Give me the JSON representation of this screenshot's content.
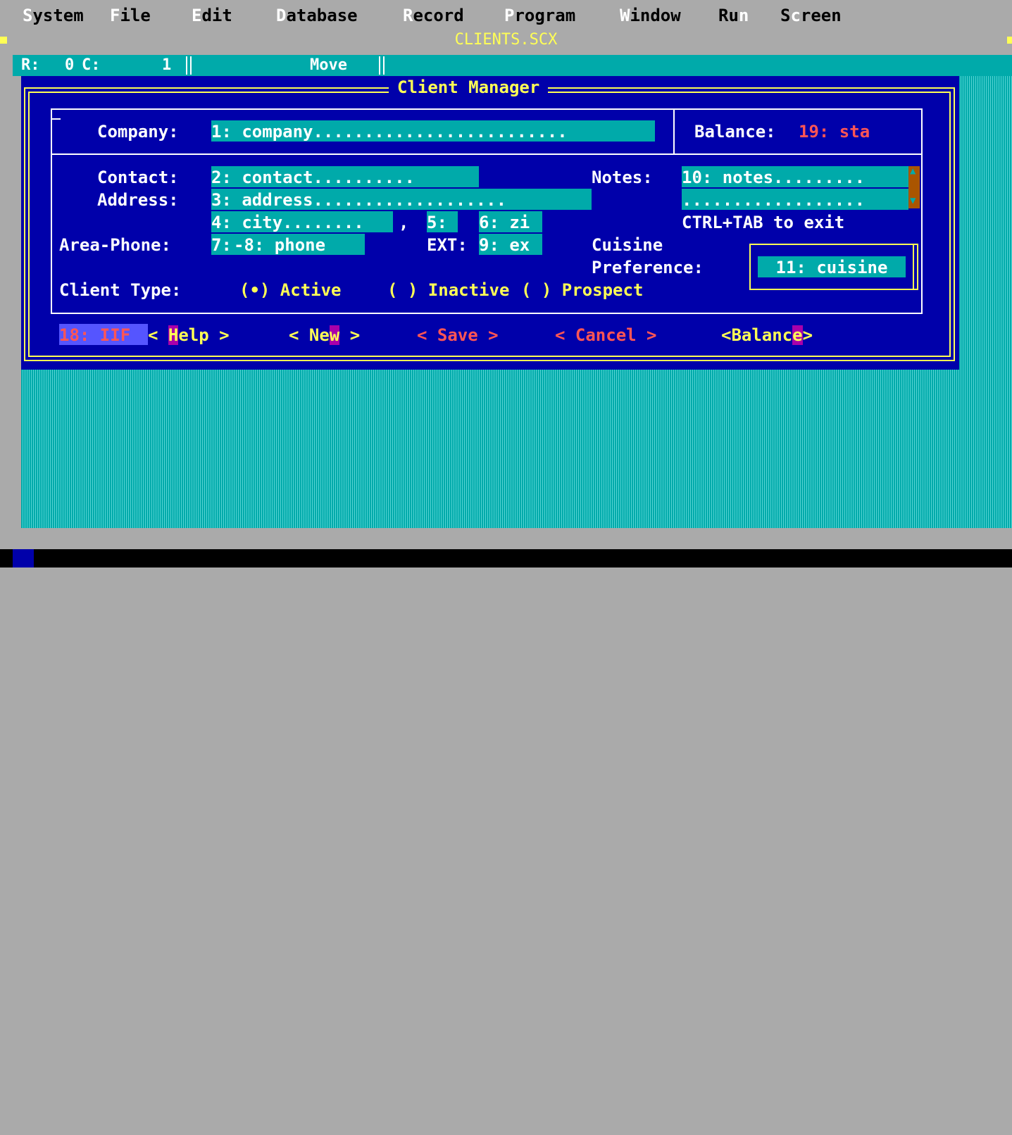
{
  "menu": {
    "items": [
      {
        "hot": "S",
        "rest": "ystem"
      },
      {
        "hot": "F",
        "rest": "ile"
      },
      {
        "hot": "E",
        "rest": "dit"
      },
      {
        "hot": "D",
        "rest": "atabase"
      },
      {
        "hot": "R",
        "rest": "ecord"
      },
      {
        "hot": "P",
        "rest": "rogram"
      },
      {
        "hot": "W",
        "rest": "indow"
      },
      {
        "pre": "Ru",
        "hot": "n",
        "rest": ""
      },
      {
        "pre": "S",
        "hot": "c",
        "rest": "reen"
      }
    ]
  },
  "window_title": "CLIENTS.SCX",
  "status": {
    "r_label": "R:",
    "r_value": "0",
    "c_label": "C:",
    "c_value": "1",
    "mode": "Move"
  },
  "panel": {
    "title": "Client Manager",
    "company_label": "Company:",
    "company_field": "1: company.........................",
    "balance_label": "Balance:",
    "balance_field": "19: sta",
    "contact_label": "Contact:",
    "contact_field": "2: contact..........",
    "address_label": "Address:",
    "address_field": "3: address...................",
    "city_field": "4: city........",
    "comma": ",",
    "state_field": "5:",
    "zip_field": "6: zi",
    "phone_label": "Area-Phone:",
    "area_field": "7:",
    "phone_field": "-8: phone",
    "ext_label": "EXT:",
    "ext_field": "9: ex",
    "notes_label": "Notes:",
    "notes_field": "10: notes.........",
    "notes_field2": "..................",
    "notes_hint": "CTRL+TAB to exit",
    "cuisine_label1": "Cuisine",
    "cuisine_label2": "Preference:",
    "cuisine_field": "11: cuisine",
    "clienttype_label": "Client Type:",
    "radio_active": "(•) Active",
    "radio_inactive": "( ) Inactive",
    "radio_prospect": "( ) Prospect"
  },
  "buttons": {
    "iif_field": "18: IIF",
    "help": {
      "pre": "< ",
      "hot": "H",
      "rest": "elp >"
    },
    "new": {
      "pre": "< Ne",
      "hot": "w",
      "rest": " >"
    },
    "save": "< Save >",
    "cancel": "< Cancel >",
    "balance": {
      "pre": "<Balanc",
      "hot": "e",
      "rest": ">"
    }
  },
  "colors": {
    "window_bg": "#0000aa",
    "field_bg": "#00aaaa",
    "frame": "#ffff55",
    "hotkey_bg": "#aa00aa",
    "disabled_text": "#ff5555"
  }
}
